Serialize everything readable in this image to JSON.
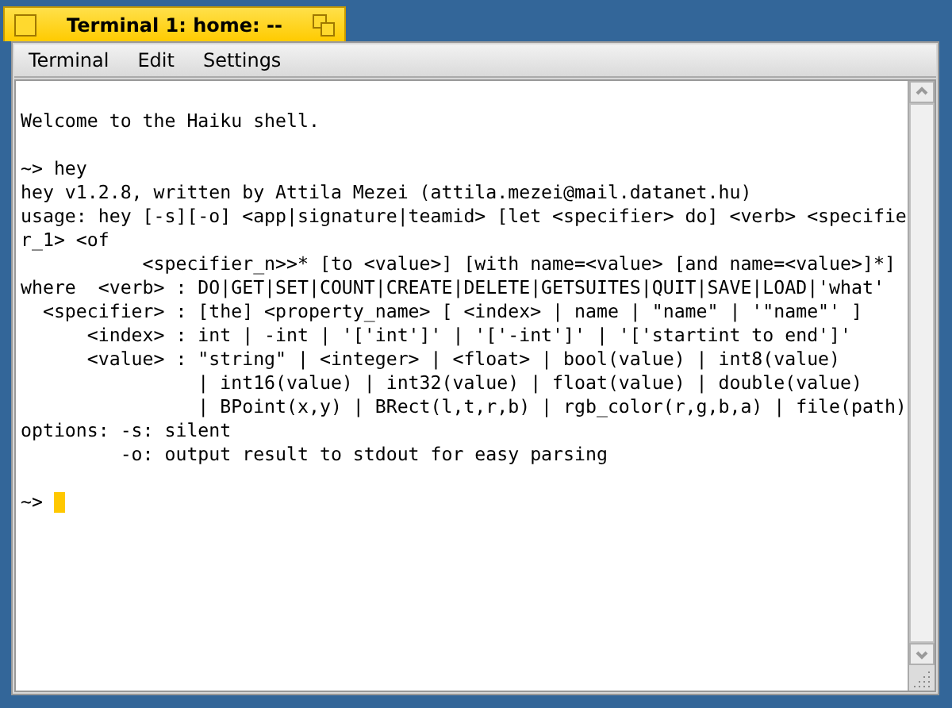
{
  "window": {
    "title": "Terminal 1: home: --"
  },
  "menu": [
    {
      "label": "Terminal"
    },
    {
      "label": "Edit"
    },
    {
      "label": "Settings"
    }
  ],
  "terminal": {
    "lines": [
      {
        "kind": "text",
        "text": "Welcome to the Haiku shell."
      },
      {
        "kind": "blank"
      },
      {
        "kind": "text",
        "text": "~> hey"
      },
      {
        "kind": "text",
        "text": "hey v1.2.8, written by Attila Mezei (attila.mezei@mail.datanet.hu)"
      },
      {
        "kind": "text",
        "text": "usage: hey [-s][-o] <app|signature|teamid> [let <specifier> do] <verb> <specifie"
      },
      {
        "kind": "text",
        "text": "r_1> <of"
      },
      {
        "kind": "text",
        "text": "           <specifier_n>>* [to <value>] [with name=<value> [and name=<value>]*]"
      },
      {
        "kind": "text",
        "text": "where  <verb> : DO|GET|SET|COUNT|CREATE|DELETE|GETSUITES|QUIT|SAVE|LOAD|'what'"
      },
      {
        "kind": "text",
        "text": "  <specifier> : [the] <property_name> [ <index> | name | \"name\" | '\"name\"' ]"
      },
      {
        "kind": "text",
        "text": "      <index> : int | -int | '['int']' | '['-int']' | '['startint to end']'"
      },
      {
        "kind": "text",
        "text": "      <value> : \"string\" | <integer> | <float> | bool(value) | int8(value)"
      },
      {
        "kind": "text",
        "text": "                | int16(value) | int32(value) | float(value) | double(value)"
      },
      {
        "kind": "text",
        "text": "                | BPoint(x,y) | BRect(l,t,r,b) | rgb_color(r,g,b,a) | file(path)"
      },
      {
        "kind": "text",
        "text": "options: -s: silent"
      },
      {
        "kind": "text",
        "text": "         -o: output result to stdout for easy parsing"
      },
      {
        "kind": "blank"
      },
      {
        "kind": "prompt",
        "text": "~>"
      }
    ]
  }
}
